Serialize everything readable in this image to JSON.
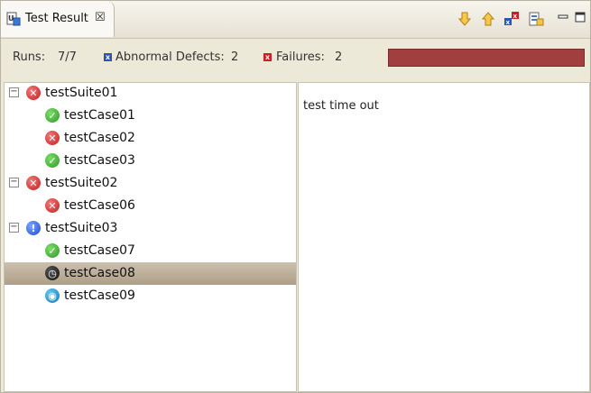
{
  "tab": {
    "title": "Test Result",
    "close_label": "☒"
  },
  "toolbar": {
    "icons": [
      "next-failure-icon",
      "previous-failure-icon",
      "show-failures-only-icon",
      "history-icon"
    ]
  },
  "stats": {
    "runs_label": "Runs:",
    "runs_value": "7/7",
    "abnormal_label": "Abnormal Defects:",
    "abnormal_value": "2",
    "failures_label": "Failures:",
    "failures_value": "2"
  },
  "progress": {
    "fraction": 1.0,
    "color": "#a13f3e"
  },
  "tree": [
    {
      "label": "testSuite01",
      "level": 0,
      "status": "error",
      "expanded": true
    },
    {
      "label": "testCase01",
      "level": 1,
      "status": "ok"
    },
    {
      "label": "testCase02",
      "level": 1,
      "status": "error"
    },
    {
      "label": "testCase03",
      "level": 1,
      "status": "ok"
    },
    {
      "label": "testSuite02",
      "level": 0,
      "status": "error",
      "expanded": true
    },
    {
      "label": "testCase06",
      "level": 1,
      "status": "error"
    },
    {
      "label": "testSuite03",
      "level": 0,
      "status": "info",
      "expanded": true
    },
    {
      "label": "testCase07",
      "level": 1,
      "status": "ok"
    },
    {
      "label": "testCase08",
      "level": 1,
      "status": "timeout",
      "selected": true
    },
    {
      "label": "testCase09",
      "level": 1,
      "status": "skipped"
    }
  ],
  "detail": {
    "message": "test time out"
  },
  "colors": {
    "error": "#c21d1d",
    "ok": "#2b9a22",
    "selection": "#b8aa93"
  }
}
